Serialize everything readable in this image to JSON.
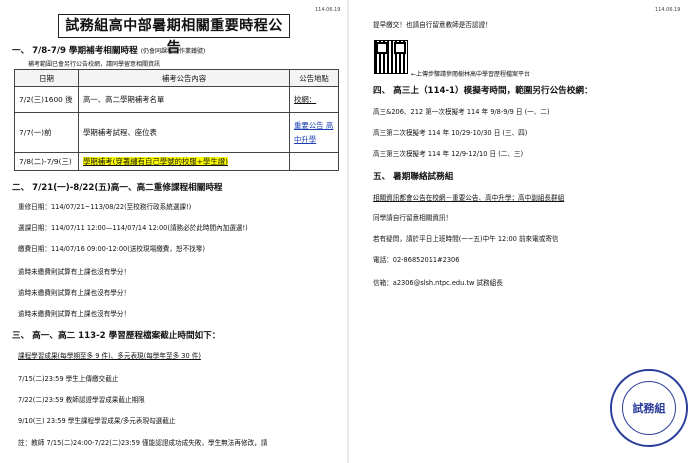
{
  "left_page": {
    "date": "114.06.19",
    "title": "試務組高中部暑期相關重要時程公告",
    "section1": {
      "heading": "一、 7/8-7/9 學期補考相關時程",
      "heading_note": "(仍會同課程暨作業鐵號)",
      "note": "補考範圍已會另行公告校網，請同學留意相關資訊",
      "table": {
        "headers": [
          "日期",
          "補考公告內容",
          "公告地點"
        ],
        "rows": [
          {
            "date": "7/2(三)1600 後",
            "content": "高一、高二學期補考名單",
            "place": "校網："
          },
          {
            "date": "7/7(一)前",
            "content": "學期補考試程、座位表",
            "place": "重要公告 高中升學"
          },
          {
            "date": "7/8(二)-7/9(三)",
            "content": "學期補考(穿著繡有自己學號的校服+學生證)",
            "place": ""
          }
        ]
      }
    },
    "section2": {
      "heading": "二、 7/21(一)-8/22(五)高一、高二重修課程相關時程",
      "lines": [
        "重修日期：114/07/21~113/08/22(至校務行政系統選課!)",
        "選課日期：114/07/11 12:00—114/07/14 12:00(請務必於此時間內加選選!)",
        "繳費日期：114/07/16 09:00-12:00(送校現場繳費，恕不找零)",
        "逾時未繳費則試算有上課也沒有學分！",
        "逾時未繳費則試算有上課也沒有學分！",
        "逾時未繳費則試算有上課也沒有學分！"
      ]
    },
    "section3": {
      "heading": "三、 高一、高二 113-2 學習歷程檔案截止時間如下：",
      "sub": "課程學習成果(每學期至多 9 件)、多元表現(每學年至多 30 件)",
      "lines": [
        "7/15(二)23:59 學生上傳繳交截止",
        "7/22(二)23:59 教師認證學習成果截止期限",
        "9/10(三) 23:59 學生課程學習成果/多元表現勾選截止",
        "註：教師 7/15(二)24:00-7/22(二)23:59 僅能認證成功成失敗，學生無法再修改，請"
      ]
    }
  },
  "right_page": {
    "date": "114.06.19",
    "top_line": "提早繳交！也請自行留意教師是否認證！",
    "qr_caption": "←上傳步驟請參閱樹林高中學習歷程檔案平台",
    "section4": {
      "heading": "四、 高三上（114-1）模擬考時間，範圍另行公告校網：",
      "lines": [
        "高三&206、212 第一次模擬考 114 年 9/8-9/9 日 (一、二)",
        "高三第二次模擬考 114 年 10/29-10/30 日 (三、四)",
        "高三第三次模擬考 114 年 12/9-12/10 日 (二、三)"
      ]
    },
    "section5": {
      "heading": "五、 暑期聯絡試務組",
      "line1": "相關資訊都會公告在校網－重要公告、高中升學；高中副組長群組",
      "line2": "同學請自行留意相關資訊！",
      "line3": "若有疑問，請於平日上班時間(一~五)中午 12:00 前來電或寄信",
      "phone": "電話：02-86852011#2306",
      "email": "信箱：a2306@slsh.ntpc.edu.tw 試務組長"
    },
    "seal": {
      "main": "試務組",
      "sub": "新北市立樹林高級中學"
    }
  }
}
